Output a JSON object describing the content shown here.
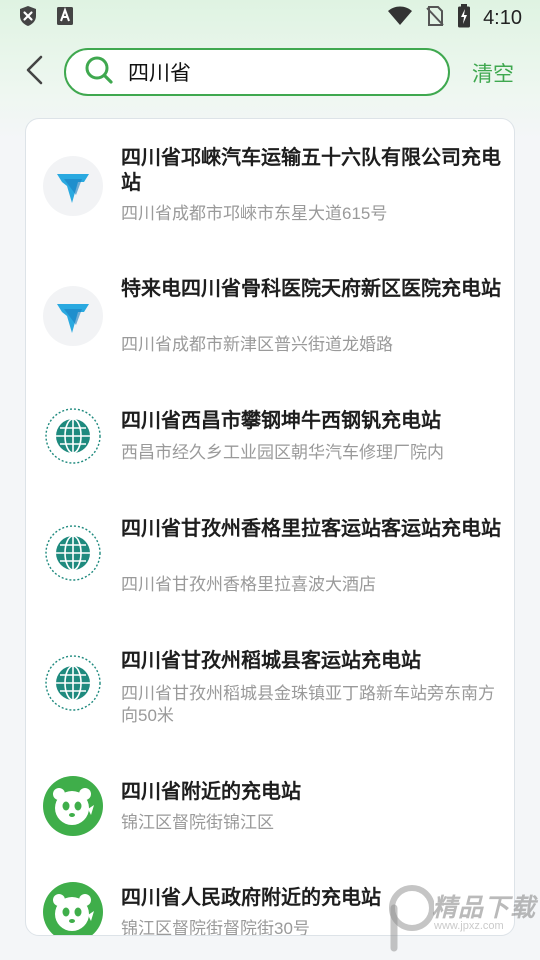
{
  "status_bar": {
    "time": "4:10",
    "icons": [
      "shield-x-icon",
      "a-badge-icon",
      "wifi-icon",
      "no-sim-icon",
      "battery-charging-icon"
    ]
  },
  "header": {
    "search_value": "四川省",
    "clear_label": "清空",
    "accent_color": "#3fa84f"
  },
  "results": [
    {
      "title": "四川省邛崍汽车运输五十六队有限公司充电站",
      "address": "四川省成都市邛崍市东星大道615号",
      "logo": "telaidian-logo"
    },
    {
      "title": "特来电四川省骨科医院天府新区医院充电站",
      "address": "四川省成都市新津区普兴街道龙婚路",
      "logo": "telaidian-logo"
    },
    {
      "title": "四川省西昌市攀钢坤牛西钢钒充电站",
      "address": "西昌市经久乡工业园区朝华汽车修理厂院内",
      "logo": "state-grid-logo"
    },
    {
      "title": "四川省甘孜州香格里拉客运站客运站充电站",
      "address": "四川省甘孜州香格里拉喜波大酒店",
      "logo": "state-grid-logo"
    },
    {
      "title": "四川省甘孜州稻城县客运站充电站",
      "address": "四川省甘孜州稻城县金珠镇亚丁路新车站旁东南方向50米",
      "logo": "state-grid-logo"
    },
    {
      "title": "四川省附近的充电站",
      "address": "锦江区督院街锦江区",
      "logo": "panda-logo"
    },
    {
      "title": "四川省人民政府附近的充电站",
      "address": "锦江区督院街督院街30号",
      "logo": "panda-logo"
    }
  ],
  "watermark": {
    "text": "精品下载",
    "sub": "www.jpxz.com"
  }
}
